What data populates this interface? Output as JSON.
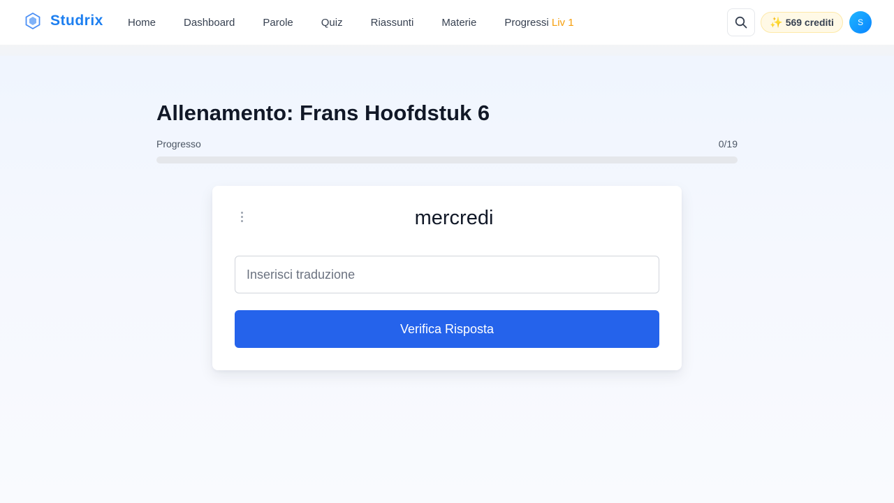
{
  "brand": {
    "name": "Studrix",
    "icon": "hexagon-logo-icon",
    "color": "#1d7ff0"
  },
  "nav": {
    "items": [
      {
        "label": "Home"
      },
      {
        "label": "Dashboard"
      },
      {
        "label": "Parole"
      },
      {
        "label": "Quiz"
      },
      {
        "label": "Riassunti"
      },
      {
        "label": "Materie"
      },
      {
        "label": "Progressi"
      }
    ],
    "level_badge": "Liv 1"
  },
  "header": {
    "search_icon": "search-icon",
    "credits_icon": "✨",
    "credits_label": "569 crediti",
    "avatar_initial": "S"
  },
  "main": {
    "title": "Allenamento: Frans Hoofdstuk 6",
    "progress": {
      "label": "Progresso",
      "count": "0/19",
      "fraction": 0
    }
  },
  "card": {
    "menu_icon": "kebab-menu-icon",
    "word": "mercredi",
    "input_value": "",
    "input_placeholder": "Inserisci traduzione",
    "submit_label": "Verifica Risposta",
    "accent": "#2563eb"
  }
}
